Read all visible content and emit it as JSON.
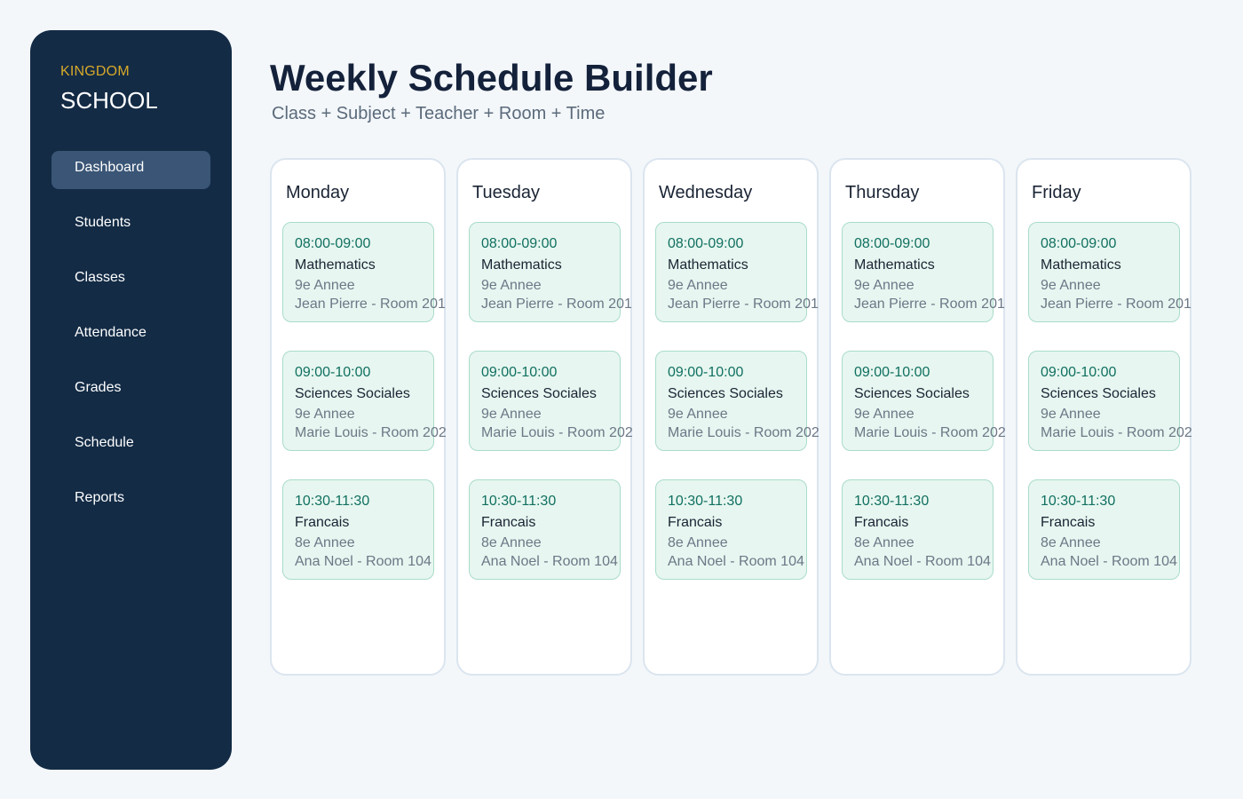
{
  "brand": {
    "top": "KINGDOM",
    "main": "SCHOOL"
  },
  "nav": [
    {
      "label": "Dashboard",
      "active": true
    },
    {
      "label": "Students"
    },
    {
      "label": "Classes"
    },
    {
      "label": "Attendance"
    },
    {
      "label": "Grades"
    },
    {
      "label": "Schedule"
    },
    {
      "label": "Reports"
    }
  ],
  "header": {
    "title": "Weekly Schedule Builder",
    "subtitle": "Class + Subject + Teacher + Room + Time"
  },
  "days": [
    {
      "name": "Monday",
      "slots": [
        {
          "time": "08:00-09:00",
          "subject": "Mathematics",
          "class": "9e Annee",
          "teacher_room": "Jean Pierre - Room 201"
        },
        {
          "time": "09:00-10:00",
          "subject": "Sciences Sociales",
          "class": "9e Annee",
          "teacher_room": "Marie Louis - Room 202"
        },
        {
          "time": "10:30-11:30",
          "subject": "Francais",
          "class": "8e Annee",
          "teacher_room": "Ana Noel - Room 104"
        }
      ]
    },
    {
      "name": "Tuesday",
      "slots": [
        {
          "time": "08:00-09:00",
          "subject": "Mathematics",
          "class": "9e Annee",
          "teacher_room": "Jean Pierre - Room 201"
        },
        {
          "time": "09:00-10:00",
          "subject": "Sciences Sociales",
          "class": "9e Annee",
          "teacher_room": "Marie Louis - Room 202"
        },
        {
          "time": "10:30-11:30",
          "subject": "Francais",
          "class": "8e Annee",
          "teacher_room": "Ana Noel - Room 104"
        }
      ]
    },
    {
      "name": "Wednesday",
      "slots": [
        {
          "time": "08:00-09:00",
          "subject": "Mathematics",
          "class": "9e Annee",
          "teacher_room": "Jean Pierre - Room 201"
        },
        {
          "time": "09:00-10:00",
          "subject": "Sciences Sociales",
          "class": "9e Annee",
          "teacher_room": "Marie Louis - Room 202"
        },
        {
          "time": "10:30-11:30",
          "subject": "Francais",
          "class": "8e Annee",
          "teacher_room": "Ana Noel - Room 104"
        }
      ]
    },
    {
      "name": "Thursday",
      "slots": [
        {
          "time": "08:00-09:00",
          "subject": "Mathematics",
          "class": "9e Annee",
          "teacher_room": "Jean Pierre - Room 201"
        },
        {
          "time": "09:00-10:00",
          "subject": "Sciences Sociales",
          "class": "9e Annee",
          "teacher_room": "Marie Louis - Room 202"
        },
        {
          "time": "10:30-11:30",
          "subject": "Francais",
          "class": "8e Annee",
          "teacher_room": "Ana Noel - Room 104"
        }
      ]
    },
    {
      "name": "Friday",
      "slots": [
        {
          "time": "08:00-09:00",
          "subject": "Mathematics",
          "class": "9e Annee",
          "teacher_room": "Jean Pierre - Room 201"
        },
        {
          "time": "09:00-10:00",
          "subject": "Sciences Sociales",
          "class": "9e Annee",
          "teacher_room": "Marie Louis - Room 202"
        },
        {
          "time": "10:30-11:30",
          "subject": "Francais",
          "class": "8e Annee",
          "teacher_room": "Ana Noel - Room 104"
        }
      ]
    }
  ]
}
